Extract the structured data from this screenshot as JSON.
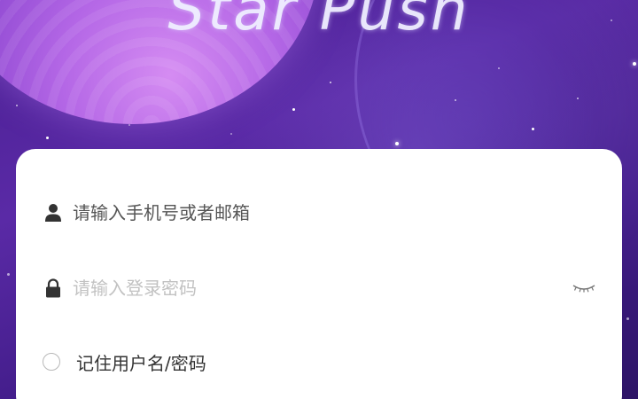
{
  "app": {
    "title": "Star Push"
  },
  "login": {
    "account_placeholder": "请输入手机号或者邮箱",
    "account_value": "",
    "password_placeholder": "请输入登录密码",
    "password_value": "",
    "remember_label": "记住用户名/密码",
    "remember_checked": false
  },
  "icons": {
    "account": "user-icon",
    "password": "lock-icon",
    "toggle_visibility": "eye-closed-icon"
  },
  "colors": {
    "background": "#4a1f93",
    "card": "#ffffff",
    "icon": "#333333",
    "placeholder_primary": "#555555",
    "placeholder_secondary": "#c2c2c2"
  }
}
